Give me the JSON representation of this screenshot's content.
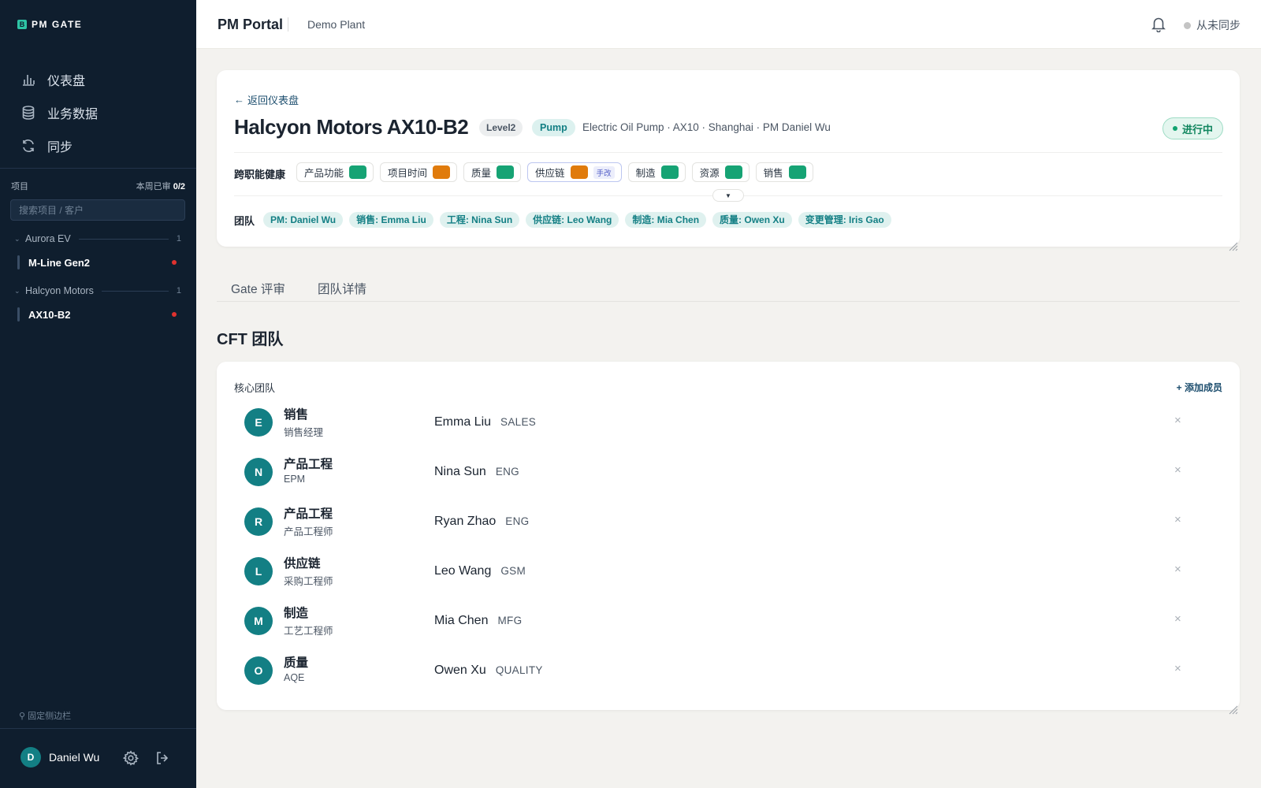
{
  "sidebar": {
    "logo_text": "PM GATE",
    "logo_mark": "B",
    "nav": [
      {
        "label": "仪表盘",
        "icon": "bar-chart-icon"
      },
      {
        "label": "业务数据",
        "icon": "database-icon"
      },
      {
        "label": "同步",
        "icon": "refresh-icon"
      }
    ],
    "projects_label": "项目",
    "weekly_prefix": "本周已审",
    "weekly_value": "0/2",
    "search_placeholder": "搜索项目 / 客户",
    "groups": [
      {
        "name": "Aurora EV",
        "count": "1",
        "projects": [
          {
            "name": "M-Line Gen2"
          }
        ]
      },
      {
        "name": "Halcyon Motors",
        "count": "1",
        "projects": [
          {
            "name": "AX10-B2"
          }
        ]
      }
    ],
    "pin_label": "固定侧边栏",
    "user": {
      "initial": "D",
      "name": "Daniel Wu"
    },
    "colors": {
      "bg": "#0f1e2e",
      "alert_dot": "#e0322f"
    }
  },
  "topbar": {
    "app_title": "PM Portal",
    "plant": "Demo Plant",
    "sync_status": "从未同步"
  },
  "project": {
    "back_label": "返回仪表盘",
    "title": "Halcyon Motors AX10-B2",
    "level": "Level2",
    "type": "Pump",
    "meta": "Electric Oil Pump · AX10 · Shanghai · PM Daniel Wu",
    "status": "进行中",
    "health_label": "跨职能健康",
    "health": [
      {
        "label": "产品功能",
        "color": "#16a374"
      },
      {
        "label": "项目时间",
        "color": "#e07b0c"
      },
      {
        "label": "质量",
        "color": "#16a374"
      },
      {
        "label": "供应链",
        "color": "#e07b0c",
        "badge": "手改"
      },
      {
        "label": "制造",
        "color": "#16a374"
      },
      {
        "label": "资源",
        "color": "#16a374"
      },
      {
        "label": "销售",
        "color": "#16a374"
      }
    ],
    "team_label": "团队",
    "team": [
      "PM: Daniel Wu",
      "销售: Emma Liu",
      "工程: Nina Sun",
      "供应链: Leo Wang",
      "制造: Mia Chen",
      "质量: Owen Xu",
      "变更管理: Iris Gao"
    ]
  },
  "tabs": [
    "Gate 评审",
    "团队详情"
  ],
  "section_title": "CFT 团队",
  "core_team": {
    "label": "核心团队",
    "add_label": "+ 添加成员",
    "remove_glyph": "×",
    "members": [
      {
        "initial": "E",
        "function": "销售",
        "role": "销售经理",
        "name": "Emma Liu",
        "dept": "SALES"
      },
      {
        "initial": "N",
        "function": "产品工程",
        "role": "EPM",
        "name": "Nina Sun",
        "dept": "ENG"
      },
      {
        "initial": "R",
        "function": "产品工程",
        "role": "产品工程师",
        "name": "Ryan Zhao",
        "dept": "ENG"
      },
      {
        "initial": "L",
        "function": "供应链",
        "role": "采购工程师",
        "name": "Leo Wang",
        "dept": "GSM"
      },
      {
        "initial": "M",
        "function": "制造",
        "role": "工艺工程师",
        "name": "Mia Chen",
        "dept": "MFG"
      },
      {
        "initial": "O",
        "function": "质量",
        "role": "AQE",
        "name": "Owen Xu",
        "dept": "QUALITY"
      }
    ]
  }
}
